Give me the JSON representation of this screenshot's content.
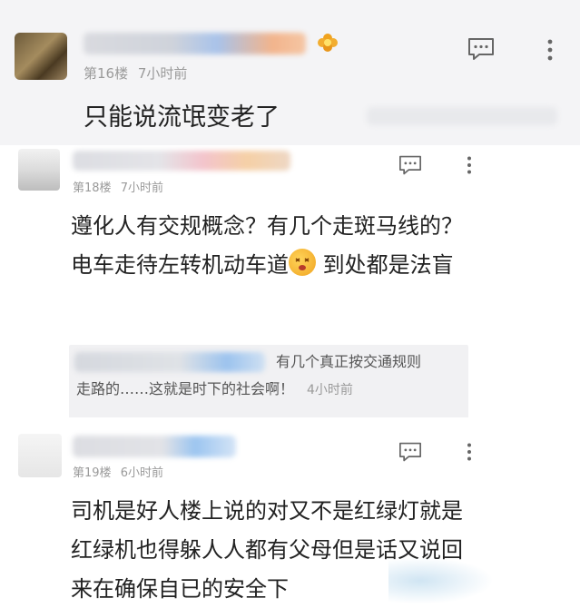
{
  "comments": [
    {
      "floor": "第16楼",
      "time": "7小时前",
      "text": "只能说流氓变老了"
    },
    {
      "floor": "第18楼",
      "time": "7小时前",
      "text_part1": "遵化人有交规概念？有几个走斑马线的？电车走待左转机动车道",
      "text_part2": " 到处都是法盲",
      "reply": {
        "text_line1": "有几个真正按交通规则",
        "text_line2": "走路的……这就是时下的社会啊！",
        "time": "4小时前"
      }
    },
    {
      "floor": "第19楼",
      "time": "6小时前",
      "text": "司机是好人楼上说的对又不是红绿灯就是红绿机也得躲人人都有父母但是话又说回来在确保自已的安全下"
    }
  ],
  "icons": {
    "comment": "comment-bubble-icon",
    "more": "more-vertical-icon",
    "badge": "flower-badge-icon",
    "emoji": "dizzy-face-emoji"
  },
  "colors": {
    "meta_text": "#9a9a9a",
    "body_text": "#222222",
    "reply_bg": "#f1f1f3",
    "divider_bg": "#f4f4f6"
  }
}
